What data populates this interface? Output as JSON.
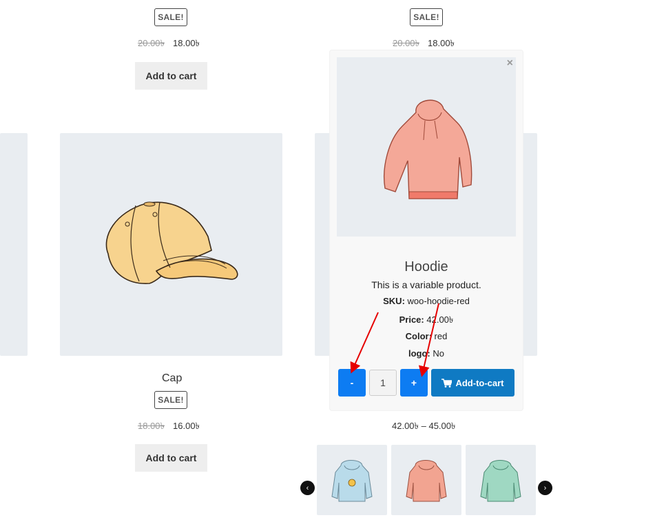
{
  "top_left_product": {
    "sale_badge": "SALE!",
    "price_old": "20.00৳",
    "price_new": "18.00৳",
    "add_to_cart": "Add to cart"
  },
  "top_right_product": {
    "sale_badge": "SALE!",
    "price_old": "20.00৳",
    "price_new": "18.00৳"
  },
  "cap_product": {
    "title": "Cap",
    "sale_badge": "SALE!",
    "price_old": "18.00৳",
    "price_new": "16.00৳",
    "add_to_cart": "Add to cart"
  },
  "hoodie_product": {
    "price_range": "42.00৳ – 45.00৳"
  },
  "quick_view": {
    "close_symbol": "×",
    "title": "Hoodie",
    "description": "This is a variable product.",
    "sku_label": "SKU:",
    "sku_value": "woo-hoodie-red",
    "price_label": "Price:",
    "price_value": "42.00৳",
    "color_label": "Color:",
    "color_value": "red",
    "logo_label": "logo:",
    "logo_value": "No",
    "minus_label": "-",
    "quantity": "1",
    "plus_label": "+",
    "add_to_cart": "Add-to-cart"
  },
  "gallery": {
    "prev_symbol": "‹",
    "next_symbol": "›"
  },
  "colors": {
    "qty_button": "#0d7cf2",
    "add_to_cart_button": "#0f7ac3",
    "annotation_arrow": "#e60000",
    "tile_bg": "#e9edf1"
  }
}
